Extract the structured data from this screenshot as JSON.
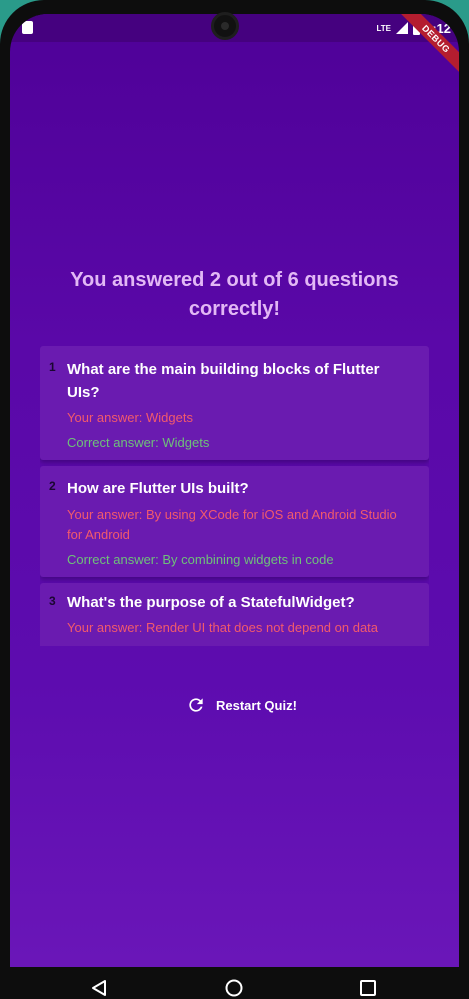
{
  "statusbar": {
    "network": "LTE",
    "time": "2:12",
    "debug_label": "DEBUG"
  },
  "summary": {
    "title": "You answered 2 out of 6 questions correctly!"
  },
  "questions": [
    {
      "index": "1",
      "question": "What are the main building blocks of Flutter UIs?",
      "user_answer": "Your answer: Widgets",
      "correct_answer": "Correct answer: Widgets"
    },
    {
      "index": "2",
      "question": "How are Flutter UIs built?",
      "user_answer": "Your answer: By using XCode for iOS and Android Studio for Android",
      "correct_answer": "Correct answer: By combining widgets in code"
    },
    {
      "index": "3",
      "question": "What's the purpose of a StatefulWidget?",
      "user_answer": "Your answer: Render UI that does not depend on data"
    }
  ],
  "restart": {
    "label": "Restart Quiz!",
    "icon": "refresh-icon"
  },
  "colors": {
    "background": "#5a08a8",
    "card": "#6a1bb0",
    "title": "#e2b8f5",
    "wrong_answer": "#f25a6c",
    "correct_answer": "#6fc07a"
  }
}
